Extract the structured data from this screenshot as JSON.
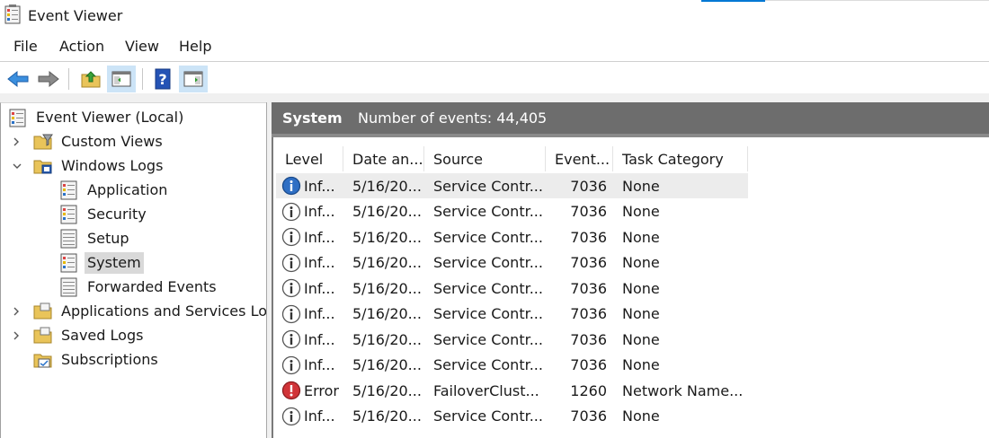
{
  "window": {
    "title": "Event Viewer"
  },
  "menu": [
    "File",
    "Action",
    "View",
    "Help"
  ],
  "toolbar": {
    "buttons": [
      {
        "name": "back-button",
        "icon": "arrow-left-icon"
      },
      {
        "name": "forward-button",
        "icon": "arrow-right-icon"
      },
      {
        "name": "up-folder-button",
        "icon": "folder-up-icon"
      },
      {
        "name": "show-hide-console-tree-button",
        "icon": "console-tree-icon",
        "pressed": true
      },
      {
        "name": "help-button",
        "icon": "help-icon"
      },
      {
        "name": "show-hide-action-pane-button",
        "icon": "action-pane-icon",
        "pressed": true
      }
    ]
  },
  "tree": {
    "root": "Event Viewer (Local)",
    "items": [
      {
        "label": "Custom Views",
        "expanded": false
      },
      {
        "label": "Windows Logs",
        "expanded": true,
        "children": [
          "Application",
          "Security",
          "Setup",
          "System",
          "Forwarded Events"
        ]
      },
      {
        "label": "Applications and Services Log",
        "expanded": false
      },
      {
        "label": "Saved Logs",
        "expanded": false
      },
      {
        "label": "Subscriptions"
      }
    ],
    "selected": "System"
  },
  "log": {
    "name": "System",
    "count_text": "Number of events: 44,405"
  },
  "table": {
    "columns": [
      "Level",
      "Date an...",
      "Source",
      "Event...",
      "Task Category"
    ],
    "rows": [
      {
        "level": "Inf...",
        "type": "info",
        "date": "5/16/20...",
        "source": "Service Contr...",
        "event": "7036",
        "category": "None"
      },
      {
        "level": "Inf...",
        "type": "info",
        "date": "5/16/20...",
        "source": "Service Contr...",
        "event": "7036",
        "category": "None"
      },
      {
        "level": "Inf...",
        "type": "info",
        "date": "5/16/20...",
        "source": "Service Contr...",
        "event": "7036",
        "category": "None"
      },
      {
        "level": "Inf...",
        "type": "info",
        "date": "5/16/20...",
        "source": "Service Contr...",
        "event": "7036",
        "category": "None"
      },
      {
        "level": "Inf...",
        "type": "info",
        "date": "5/16/20...",
        "source": "Service Contr...",
        "event": "7036",
        "category": "None"
      },
      {
        "level": "Inf...",
        "type": "info",
        "date": "5/16/20...",
        "source": "Service Contr...",
        "event": "7036",
        "category": "None"
      },
      {
        "level": "Inf...",
        "type": "info",
        "date": "5/16/20...",
        "source": "Service Contr...",
        "event": "7036",
        "category": "None"
      },
      {
        "level": "Inf...",
        "type": "info",
        "date": "5/16/20...",
        "source": "Service Contr...",
        "event": "7036",
        "category": "None"
      },
      {
        "level": "Error",
        "type": "error",
        "date": "5/16/20...",
        "source": "FailoverClust...",
        "event": "1260",
        "category": "Network Name..."
      },
      {
        "level": "Inf...",
        "type": "info",
        "date": "5/16/20...",
        "source": "Service Contr...",
        "event": "7036",
        "category": "None"
      }
    ]
  },
  "colors": {
    "accent": "#0078d4",
    "header_bg": "#6d6d6d",
    "info": "#1f5fa8",
    "error": "#d13438"
  }
}
